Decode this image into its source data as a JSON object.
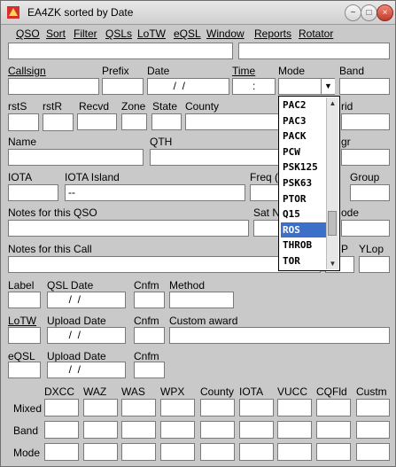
{
  "window": {
    "title": "EA4ZK sorted by Date"
  },
  "menu": [
    "QSO",
    "Sort",
    "Filter",
    "QSLs",
    "LoTW",
    "eQSL",
    "Window",
    "Reports",
    "Rotator"
  ],
  "labels": {
    "callsign": "Callsign",
    "prefix": "Prefix",
    "date": "Date",
    "time": "Time",
    "mode": "Mode",
    "band": "Band",
    "rsts": "rstS",
    "rstr": "rstR",
    "recvd": "Recvd",
    "zone": "Zone",
    "state": "State",
    "county": "County",
    "grid": "rid",
    "name": "Name",
    "qth": "QTH",
    "locgr": "gr",
    "iota": "IOTA",
    "iota_island": "IOTA Island",
    "freq": "Freq (",
    "group": "Group",
    "notes_qso": "Notes for this QSO",
    "sat": "Sat N",
    "mode2": "ode",
    "notes_call": "Notes for this Call",
    "p": "P",
    "ylop": "YLop",
    "label": "Label",
    "qsl_date": "QSL Date",
    "cnfm": "Cnfm",
    "method": "Method",
    "lotw": "LoTW",
    "upload_date": "Upload Date",
    "custom_award": "Custom award",
    "eqsl": "eQSL"
  },
  "values": {
    "date": "  /  /",
    "time": ":",
    "iota_island": "--",
    "qsl_date": "  /  /",
    "lotw_date": "  /  /",
    "eqsl_date": "  /  /"
  },
  "mode_dropdown": {
    "items": [
      "PAC2",
      "PAC3",
      "PACK",
      "PCW",
      "PSK125",
      "PSK63",
      "PTOR",
      "Q15",
      "ROS",
      "THROB",
      "TOR"
    ],
    "selected": "ROS"
  },
  "grid": {
    "columns": [
      "DXCC",
      "WAZ",
      "WAS",
      "WPX",
      "County",
      "IOTA",
      "VUCC",
      "CQFld",
      "Custm"
    ],
    "rows": [
      "Mixed",
      "Band",
      "Mode"
    ]
  }
}
